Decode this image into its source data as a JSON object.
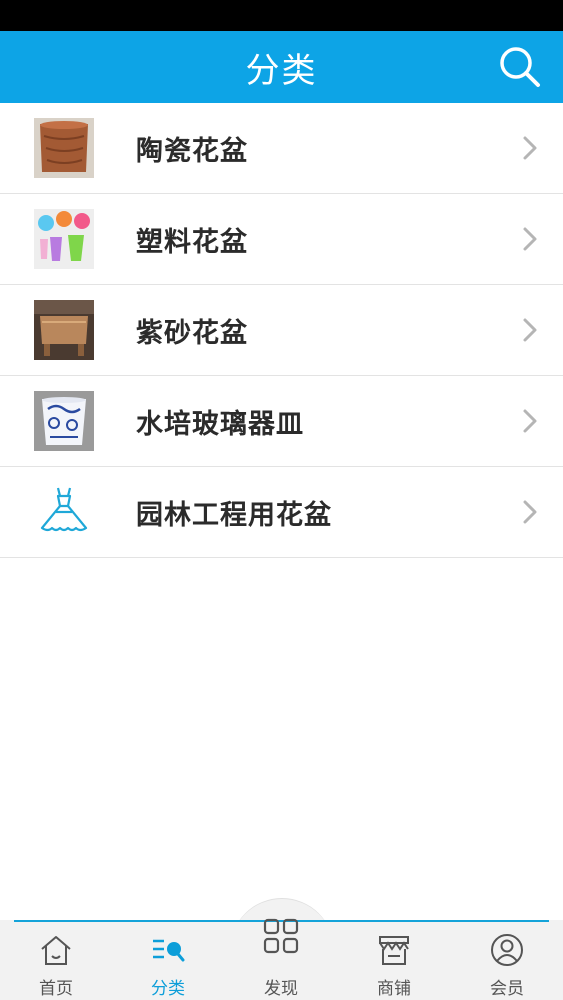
{
  "header": {
    "title": "分类"
  },
  "categories": [
    {
      "label": "陶瓷花盆",
      "thumb": "terracotta-pot"
    },
    {
      "label": "塑料花盆",
      "thumb": "plastic-pots"
    },
    {
      "label": "紫砂花盆",
      "thumb": "purple-clay-pot"
    },
    {
      "label": "水培玻璃器皿",
      "thumb": "blue-white-porcelain"
    },
    {
      "label": "园林工程用花盆",
      "thumb": "dress-icon"
    }
  ],
  "tabbar": {
    "tabs": [
      {
        "label": "首页",
        "icon": "home-icon",
        "active": false
      },
      {
        "label": "分类",
        "icon": "category-icon",
        "active": true
      },
      {
        "label": "发现",
        "icon": "grid-icon",
        "active": false
      },
      {
        "label": "商铺",
        "icon": "store-icon",
        "active": false
      },
      {
        "label": "会员",
        "icon": "user-icon",
        "active": false
      }
    ]
  },
  "colors": {
    "brand": "#0da4e6",
    "active_tab": "#0d9ed9"
  }
}
